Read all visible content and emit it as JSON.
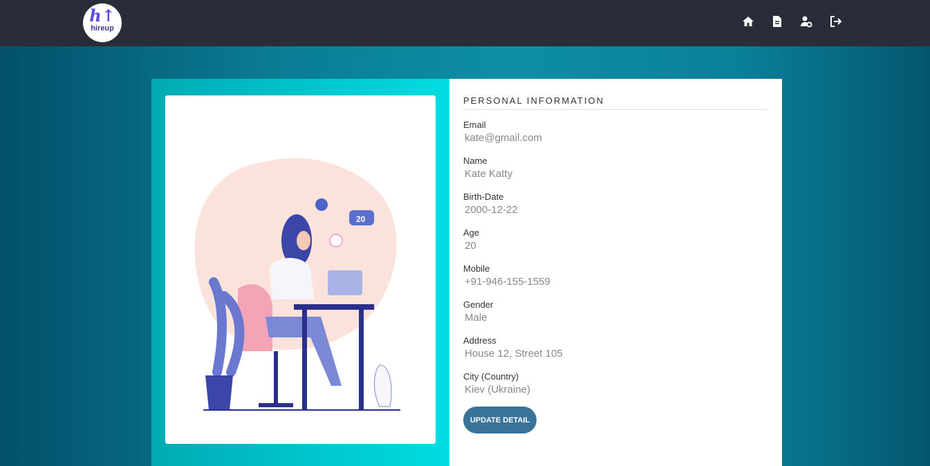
{
  "brand": {
    "logo_mark": "h↑",
    "logo_text": "hireup"
  },
  "nav": {
    "icons": [
      "home-icon",
      "document-icon",
      "user-settings-icon",
      "logout-icon"
    ]
  },
  "profile": {
    "section_title": "PERSONAL INFORMATION",
    "fields": [
      {
        "label": "Email",
        "value": "kate@gmail.com"
      },
      {
        "label": "Name",
        "value": "Kate Katty"
      },
      {
        "label": "Birth-Date",
        "value": "2000-12-22"
      },
      {
        "label": "Age",
        "value": "20"
      },
      {
        "label": "Mobile",
        "value": "+91-946-155-1559"
      },
      {
        "label": "Gender",
        "value": "Male"
      },
      {
        "label": "Address",
        "value": "House 12, Street 105"
      },
      {
        "label": "City (Country)",
        "value": "Kiev (Ukraine)"
      }
    ],
    "update_button": "UPDATE DETAIL"
  },
  "illustration": {
    "like_count": "20"
  },
  "colors": {
    "navbar": "#282d39",
    "button": "#3a7399",
    "accent": "#00dde2"
  }
}
